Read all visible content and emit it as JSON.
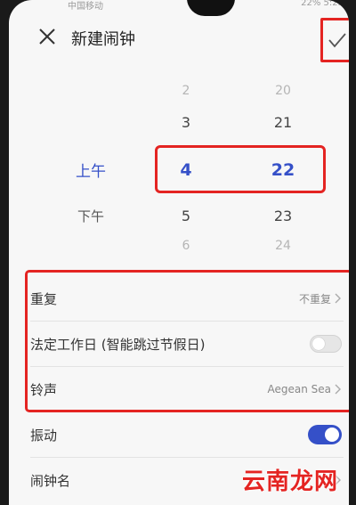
{
  "status_bar": {
    "left": "中国移动",
    "right": "22% 5:23"
  },
  "header": {
    "title": "新建闹钟"
  },
  "picker": {
    "ampm": {
      "above": "上午",
      "below": "下午"
    },
    "hours": [
      "2",
      "3",
      "4",
      "5",
      "6"
    ],
    "minutes": [
      "20",
      "21",
      "22",
      "23",
      "24"
    ]
  },
  "settings": {
    "repeat": {
      "label": "重复",
      "value": "不重复"
    },
    "workday": {
      "label": "法定工作日 (智能跳过节假日)",
      "enabled": false
    },
    "ringtone": {
      "label": "铃声",
      "value": "Aegean Sea"
    },
    "vibrate": {
      "label": "振动",
      "enabled": true
    },
    "alarm_name": {
      "label": "闹钟名"
    }
  },
  "watermark": "云南龙网",
  "colors": {
    "accent": "#3550c8",
    "highlight_red": "#e42422",
    "background": "#f7f7f7"
  }
}
